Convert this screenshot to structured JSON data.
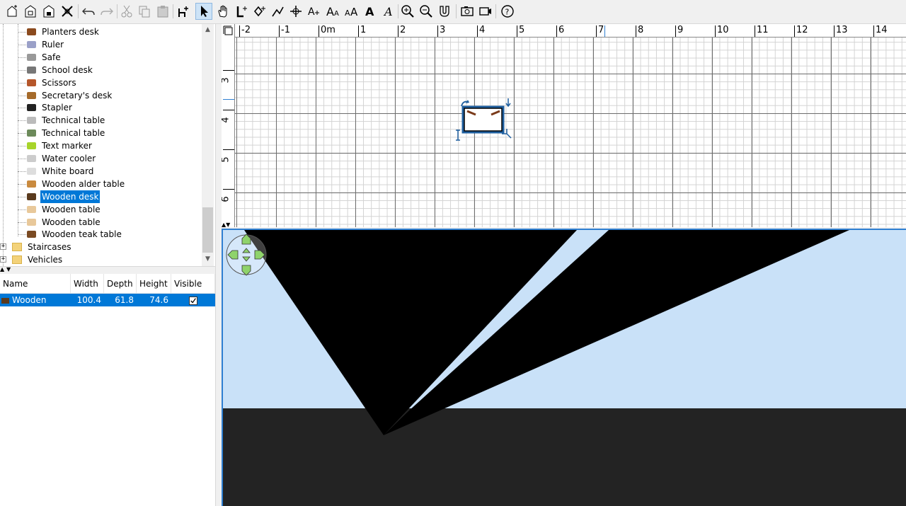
{
  "toolbar": {
    "buttons": [
      "new-home",
      "open",
      "save",
      "preferences",
      "undo",
      "redo",
      "cut",
      "copy",
      "paste",
      "add-furniture",
      "select",
      "pan",
      "create-walls",
      "create-rooms",
      "create-polylines",
      "create-dimensions",
      "add-text",
      "increase-text",
      "decrease-text",
      "bold",
      "italic",
      "zoom-in",
      "zoom-out",
      "create-photo",
      "create-video",
      "help"
    ],
    "active": "select"
  },
  "catalog": {
    "items": [
      {
        "label": "Planters desk",
        "icon": "chair"
      },
      {
        "label": "Ruler",
        "icon": "ruler"
      },
      {
        "label": "Safe",
        "icon": "safe"
      },
      {
        "label": "School desk",
        "icon": "school-desk"
      },
      {
        "label": "Scissors",
        "icon": "scissors"
      },
      {
        "label": "Secretary's desk",
        "icon": "secretary-desk"
      },
      {
        "label": "Stapler",
        "icon": "stapler"
      },
      {
        "label": "Technical table",
        "icon": "technical-table"
      },
      {
        "label": "Technical table",
        "icon": "technical-table-green"
      },
      {
        "label": "Text marker",
        "icon": "marker"
      },
      {
        "label": "Water cooler",
        "icon": "water-cooler"
      },
      {
        "label": "White board",
        "icon": "whiteboard"
      },
      {
        "label": "Wooden alder table",
        "icon": "wooden-table"
      },
      {
        "label": "Wooden desk",
        "icon": "wooden-desk",
        "selected": true
      },
      {
        "label": "Wooden table",
        "icon": "wooden-table-light"
      },
      {
        "label": "Wooden table",
        "icon": "wooden-table-light"
      },
      {
        "label": "Wooden teak table",
        "icon": "teak-table"
      }
    ],
    "categories": [
      {
        "label": "Staircases"
      },
      {
        "label": "Vehicles"
      }
    ]
  },
  "furniture_table": {
    "columns": [
      "Name",
      "Width",
      "Depth",
      "Height",
      "Visible"
    ],
    "rows": [
      {
        "name": "Wooden desk",
        "width": "100.4",
        "depth": "61.8",
        "height": "74.6",
        "visible": true
      }
    ]
  },
  "plan": {
    "ruler_x_labels": [
      "-2",
      "-1",
      "0m",
      "1",
      "2",
      "3",
      "4",
      "5",
      "6",
      "7",
      "8",
      "9",
      "10",
      "11",
      "12",
      "13",
      "14"
    ],
    "ruler_y_labels": [
      "3",
      "4",
      "5",
      "6"
    ],
    "selected_piece": "Wooden desk"
  },
  "colors": {
    "selection": "#0078d7",
    "sky": "#c9e1f8",
    "ground": "#232323",
    "plan_selection": "#1f5f9f"
  }
}
